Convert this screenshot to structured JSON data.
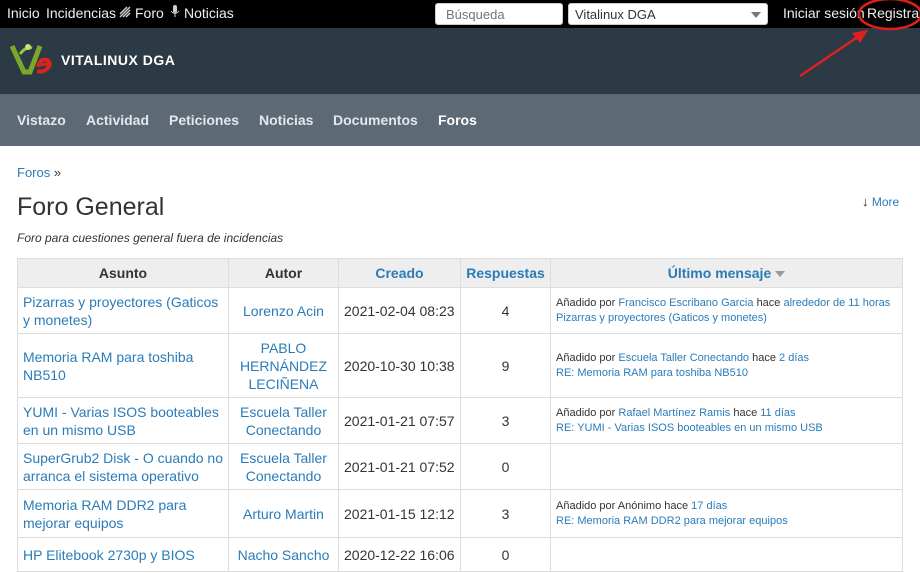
{
  "topbar": {
    "links": [
      "Inicio",
      "Incidencias",
      "Foro",
      "Noticias"
    ],
    "search_placeholder": "Búsqueda",
    "project_select": "Vitalinux DGA",
    "login": "Iniciar sesión",
    "register": "Registrar"
  },
  "header": {
    "brand": "VITALINUX DGA"
  },
  "nav": [
    "Vistazo",
    "Actividad",
    "Peticiones",
    "Noticias",
    "Documentos",
    "Foros"
  ],
  "page": {
    "breadcrumb": "Foros",
    "breadcrumb_sep": "»",
    "title": "Foro General",
    "description": "Foro para cuestiones general fuera de incidencias",
    "more": "More"
  },
  "table": {
    "headers": [
      "Asunto",
      "Autor",
      "Creado",
      "Respuestas",
      "Último mensaje"
    ],
    "rows": [
      {
        "subject": "Pizarras y proyectores (Gaticos y monetes)",
        "author": "Lorenzo Acin",
        "created": "2021-02-04 08:23",
        "replies": "4",
        "last": {
          "prefix": "Añadido por",
          "by": "Francisco Escribano Garcia",
          "mid": "hace",
          "ago": "alrededor de 11 horas",
          "msg": "Pizarras y proyectores (Gaticos y monetes)"
        }
      },
      {
        "subject": "Memoria RAM para toshiba NB510",
        "author": "PABLO HERNÁNDEZ LECIÑENA",
        "created": "2020-10-30 10:38",
        "replies": "9",
        "last": {
          "prefix": "Añadido por",
          "by": "Escuela Taller Conectando",
          "mid": "hace",
          "ago": "2 días",
          "msg": "RE: Memoria RAM para toshiba NB510"
        }
      },
      {
        "subject": "YUMI - Varias ISOS booteables en un mismo USB",
        "author": "Escuela Taller Conectando",
        "created": "2021-01-21 07:57",
        "replies": "3",
        "last": {
          "prefix": "Añadido por",
          "by": "Rafael Martínez Ramis",
          "mid": "hace",
          "ago": "11 días",
          "msg": "RE: YUMI - Varias ISOS booteables en un mismo USB"
        }
      },
      {
        "subject": "SuperGrub2 Disk - O cuando no arranca el sistema operativo",
        "author": "Escuela Taller Conectando",
        "created": "2021-01-21 07:52",
        "replies": "0",
        "last": null
      },
      {
        "subject": "Memoria RAM DDR2 para mejorar equipos",
        "author": "Arturo Martin",
        "created": "2021-01-15 12:12",
        "replies": "3",
        "last": {
          "prefix": "Añadido por Anónimo",
          "by": "",
          "mid": "hace",
          "ago": "17 días",
          "msg": "RE: Memoria RAM DDR2 para mejorar equipos"
        }
      },
      {
        "subject": "HP Elitebook 2730p y BIOS",
        "author": "Nacho Sancho",
        "created": "2020-12-22 16:06",
        "replies": "0",
        "last": null
      }
    ]
  },
  "colors": {
    "link": "#2a7cb8",
    "header_bg": "#2c3a45",
    "nav_bg": "#5d6a75",
    "annotation": "#e0201e"
  }
}
